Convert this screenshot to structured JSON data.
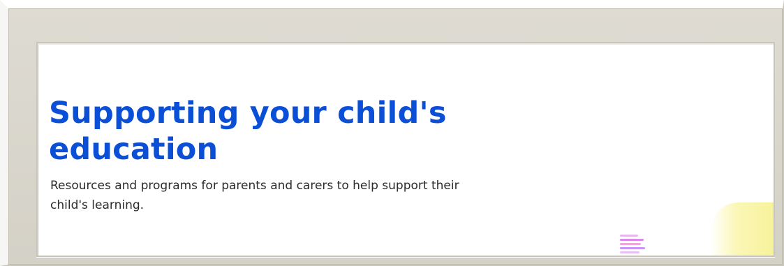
{
  "hero": {
    "title_line1": "Supporting your child's",
    "title_line2": "education",
    "subtitle_line1": "Resources and programs for parents and carers to help support their",
    "subtitle_line2": "child's learning."
  },
  "colors": {
    "title": "#0a4fd6",
    "text": "#2b2b2b",
    "frame": "#d4d1c7",
    "panel": "#ffffff"
  }
}
